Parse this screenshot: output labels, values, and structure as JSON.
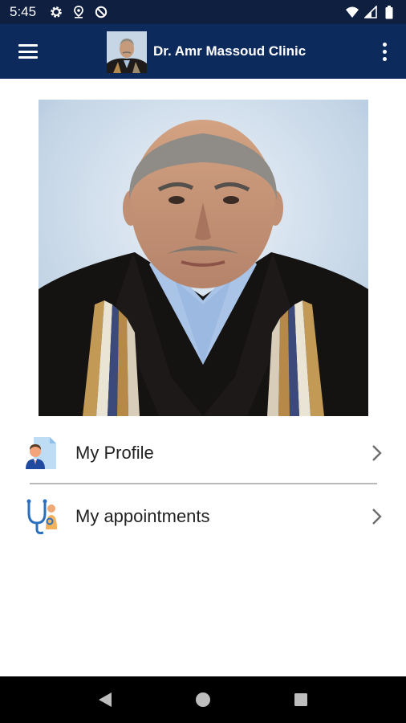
{
  "status_bar": {
    "time": "5:45",
    "left_icons": [
      "gear-icon",
      "location-pin-icon",
      "no-disturb-icon"
    ],
    "right_icons": [
      "wifi-icon",
      "signal-icon",
      "battery-icon"
    ]
  },
  "app_bar": {
    "title": "Dr. Amr Massoud Clinic",
    "menu_icon": "hamburger-menu-icon",
    "overflow_icon": "more-vert-icon"
  },
  "menu": {
    "items": [
      {
        "label": "My Profile",
        "icon": "profile-doc-icon"
      },
      {
        "label": "My appointments",
        "icon": "stethoscope-icon"
      }
    ]
  },
  "nav_bar": {
    "buttons": [
      "back-icon",
      "home-icon",
      "recents-icon"
    ]
  },
  "colors": {
    "status_bar_bg": "#0f1f3f",
    "app_bar_bg": "#0d2a5c",
    "nav_bar_bg": "#000000"
  }
}
